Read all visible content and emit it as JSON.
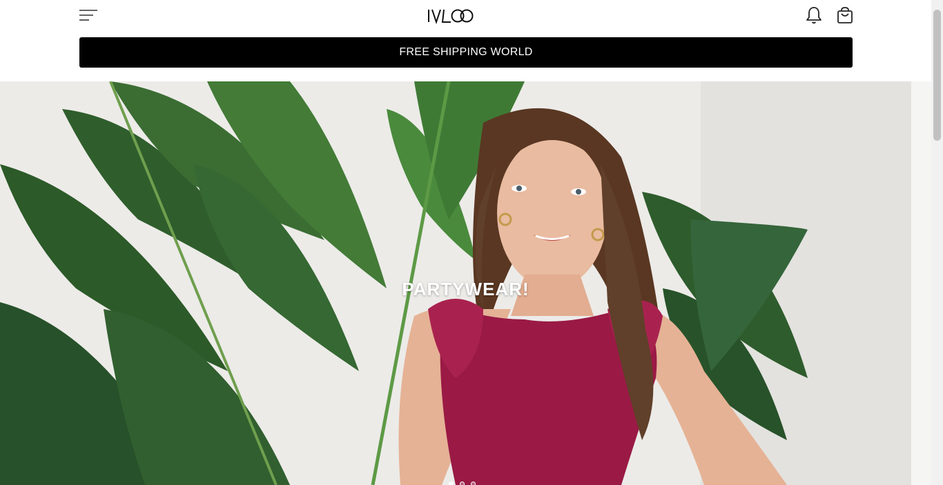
{
  "header": {
    "logo_text": "IVLOO",
    "menu_icon": "hamburger-menu-icon",
    "notification_icon": "bell-icon",
    "cart_icon": "shopping-bag-icon"
  },
  "shipping_bar": {
    "text": "FREE SHIPPING WORLD",
    "background": "#000000",
    "color": "#ffffff"
  },
  "hero": {
    "title": "PARTYWEAR!",
    "slide_count": 3,
    "active_slide": 1
  }
}
